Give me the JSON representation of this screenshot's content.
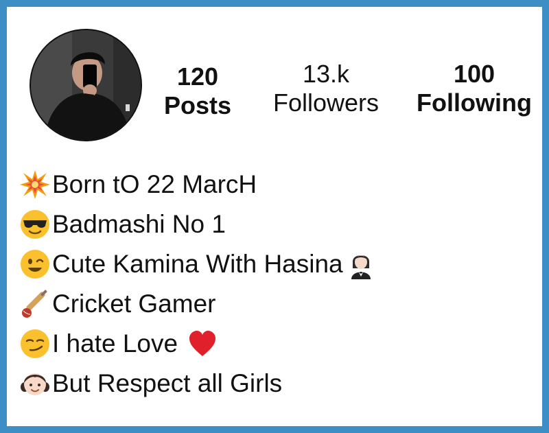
{
  "profile": {
    "avatar_icon": "profile-photo-mirror-selfie",
    "stats": {
      "posts": {
        "value": "120",
        "label": "Posts"
      },
      "followers": {
        "value": "13.k",
        "label": "Followers"
      },
      "following": {
        "value": "100",
        "label": "Following"
      }
    }
  },
  "bio": [
    {
      "icon": "collision-icon",
      "text": "Born tO 22 MarcH"
    },
    {
      "icon": "sunglasses-face-icon",
      "text": "Badmashi No 1"
    },
    {
      "icon": "winking-face-icon",
      "text": "Cute Kamina With Hasina",
      "trail_icon": "woman-in-tuxedo-icon"
    },
    {
      "icon": "cricket-bat-icon",
      "text": "Cricket Gamer"
    },
    {
      "icon": "smirking-face-icon",
      "text": "I hate Love ",
      "trail_icon": "red-heart-icon"
    },
    {
      "icon": "girl-icon",
      "text": "But Respect all Girls"
    }
  ],
  "colors": {
    "border": "#3e8ec6",
    "background": "#ffffff",
    "text": "#111111"
  }
}
